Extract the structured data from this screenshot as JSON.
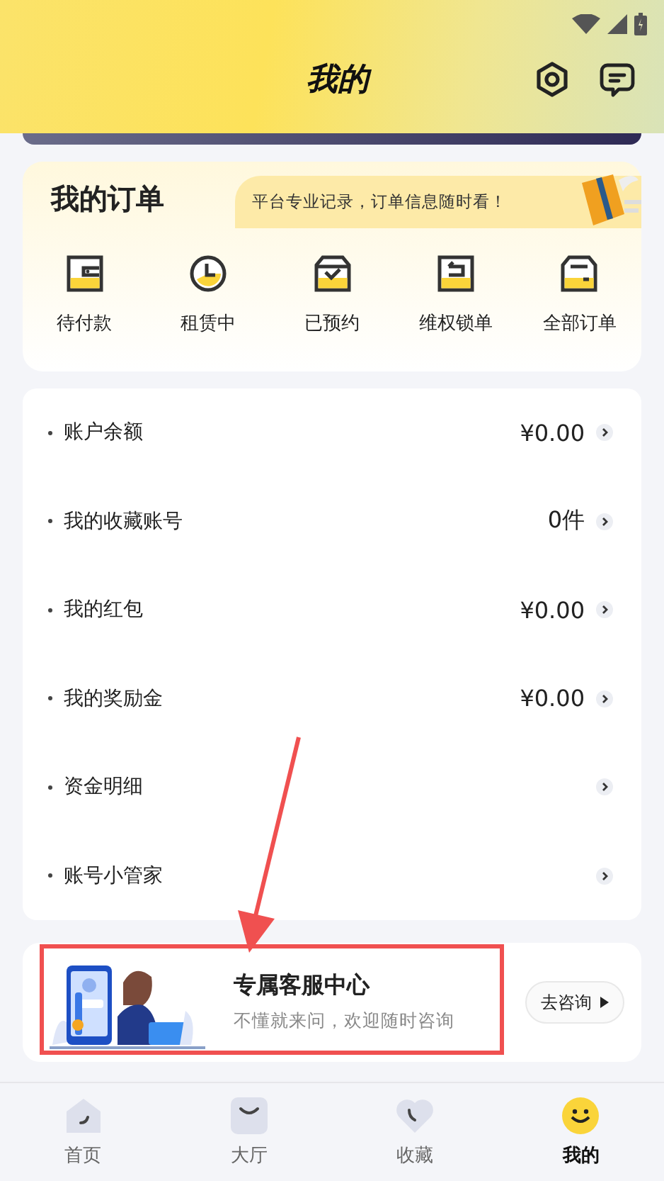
{
  "header": {
    "title": "我的"
  },
  "orders": {
    "title": "我的订单",
    "slogan": "平台专业记录，订单信息随时看！",
    "items": [
      {
        "label": "待付款",
        "kind": "wallet"
      },
      {
        "label": "租赁中",
        "kind": "clock"
      },
      {
        "label": "已预约",
        "kind": "check"
      },
      {
        "label": "维权锁单",
        "kind": "return"
      },
      {
        "label": "全部订单",
        "kind": "box"
      }
    ]
  },
  "menu": [
    {
      "label": "账户余额",
      "value": "¥0.00"
    },
    {
      "label": "我的收藏账号",
      "value": "0件"
    },
    {
      "label": "我的红包",
      "value": "¥0.00"
    },
    {
      "label": "我的奖励金",
      "value": "¥0.00"
    },
    {
      "label": "资金明细"
    },
    {
      "label": "账号小管家"
    }
  ],
  "service": {
    "title": "专属客服中心",
    "subtitle": "不懂就来问，欢迎随时咨询",
    "button": "去咨询"
  },
  "tabbar": [
    {
      "label": "首页",
      "kind": "home",
      "selected": false
    },
    {
      "label": "大厅",
      "kind": "hall",
      "selected": false
    },
    {
      "label": "收藏",
      "kind": "heart",
      "selected": false
    },
    {
      "label": "我的",
      "kind": "me",
      "selected": true
    }
  ]
}
